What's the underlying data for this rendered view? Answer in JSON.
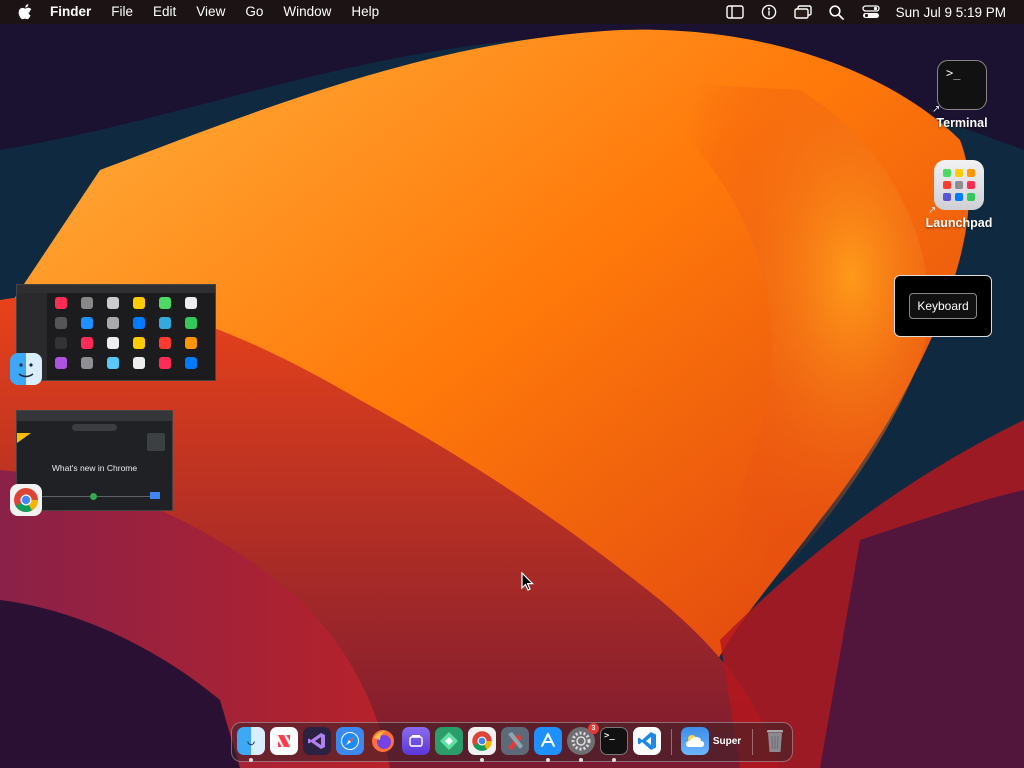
{
  "menubar": {
    "app_name": "Finder",
    "menus": [
      "File",
      "Edit",
      "View",
      "Go",
      "Window",
      "Help"
    ],
    "clock": "Sun Jul 9  5:19 PM"
  },
  "desktop_icons": {
    "terminal": "Terminal",
    "launchpad": "Launchpad"
  },
  "keyboard_widget": {
    "label": "Keyboard"
  },
  "chrome_preview": {
    "headline": "What's new in Chrome"
  },
  "dock": {
    "super_label": "Super",
    "badge_count": "3"
  },
  "colors": {
    "wallpaper_orange": "#ff8a00",
    "wallpaper_red": "#c81f14",
    "wallpaper_purple": "#4a1640"
  }
}
